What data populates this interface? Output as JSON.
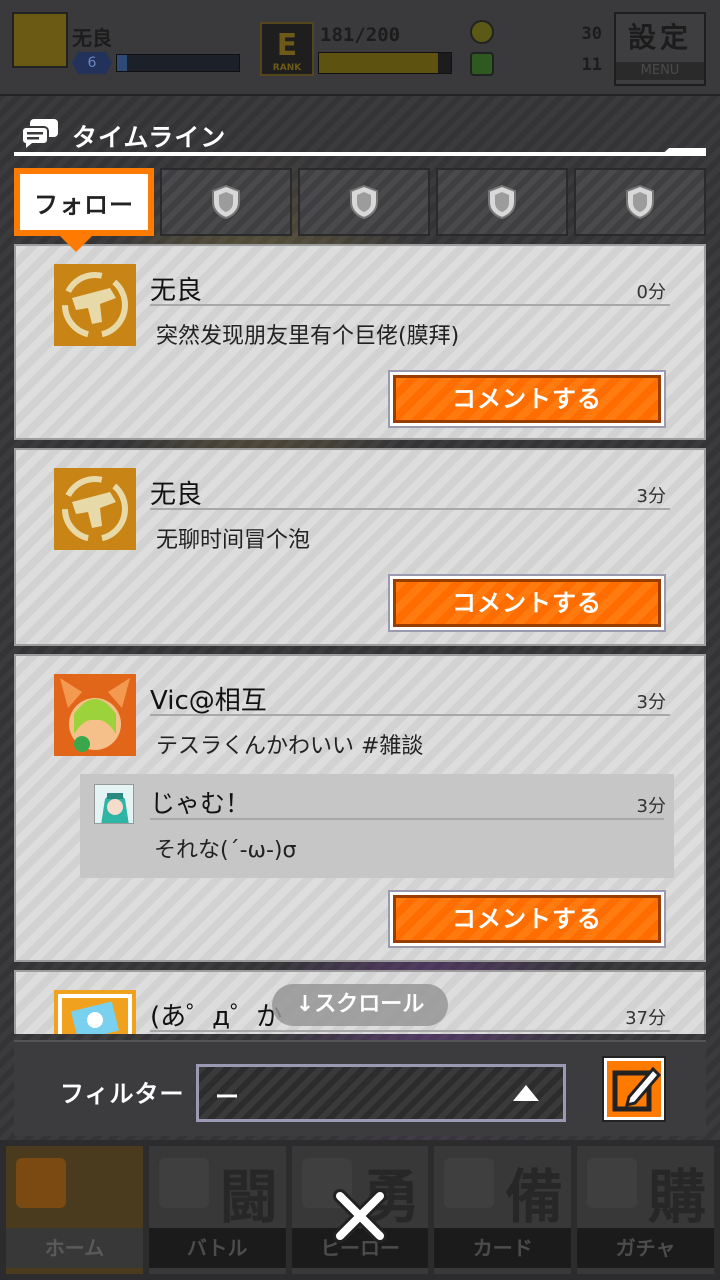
{
  "background": {
    "player_name": "无良",
    "level": "6",
    "level_progress": 0.08,
    "rank_letter": "E",
    "rank_label": "RANK",
    "exp": "181/200",
    "exp_progress": 0.9,
    "currency_1": "30",
    "currency_2": "11",
    "settings_label": "設定",
    "settings_sub": "MENU",
    "nav": [
      {
        "label": "ホーム",
        "glyph": ""
      },
      {
        "label": "バトル",
        "glyph": "闘"
      },
      {
        "label": "ヒーロー",
        "glyph": "勇"
      },
      {
        "label": "カード",
        "glyph": "備"
      },
      {
        "label": "ガチャ",
        "glyph": "購"
      }
    ]
  },
  "modal": {
    "title": "タイムライン",
    "tabs": [
      {
        "label": "フォロー",
        "active": true
      },
      {
        "label": "",
        "icon": "shield-icon"
      },
      {
        "label": "",
        "icon": "shield-icon"
      },
      {
        "label": "",
        "icon": "shield-icon"
      },
      {
        "label": "",
        "icon": "shield-icon"
      }
    ],
    "posts": [
      {
        "user": "无良",
        "time": "0分",
        "text": "突然发现朋友里有个巨佬(膜拜)",
        "button": "コメントする"
      },
      {
        "user": "无良",
        "time": "3分",
        "text": "无聊时间冒个泡",
        "button": "コメントする"
      },
      {
        "user": "Vic@相互",
        "time": "3分",
        "text": "テスラくんかわいい #雑談",
        "button": "コメントする",
        "reply": {
          "user": "じゃむ！",
          "time": "3分",
          "text": "それな(´-ω-)σ"
        }
      },
      {
        "user": "(あ゜д゜か",
        "time": "37分"
      }
    ],
    "scroll_hint": "↓スクロール",
    "filter_label": "フィルター",
    "filter_value": "ー"
  },
  "colors": {
    "accent": "#ff7a00",
    "accent_dark": "#9a3d00",
    "card_bg": "#dddddd"
  }
}
